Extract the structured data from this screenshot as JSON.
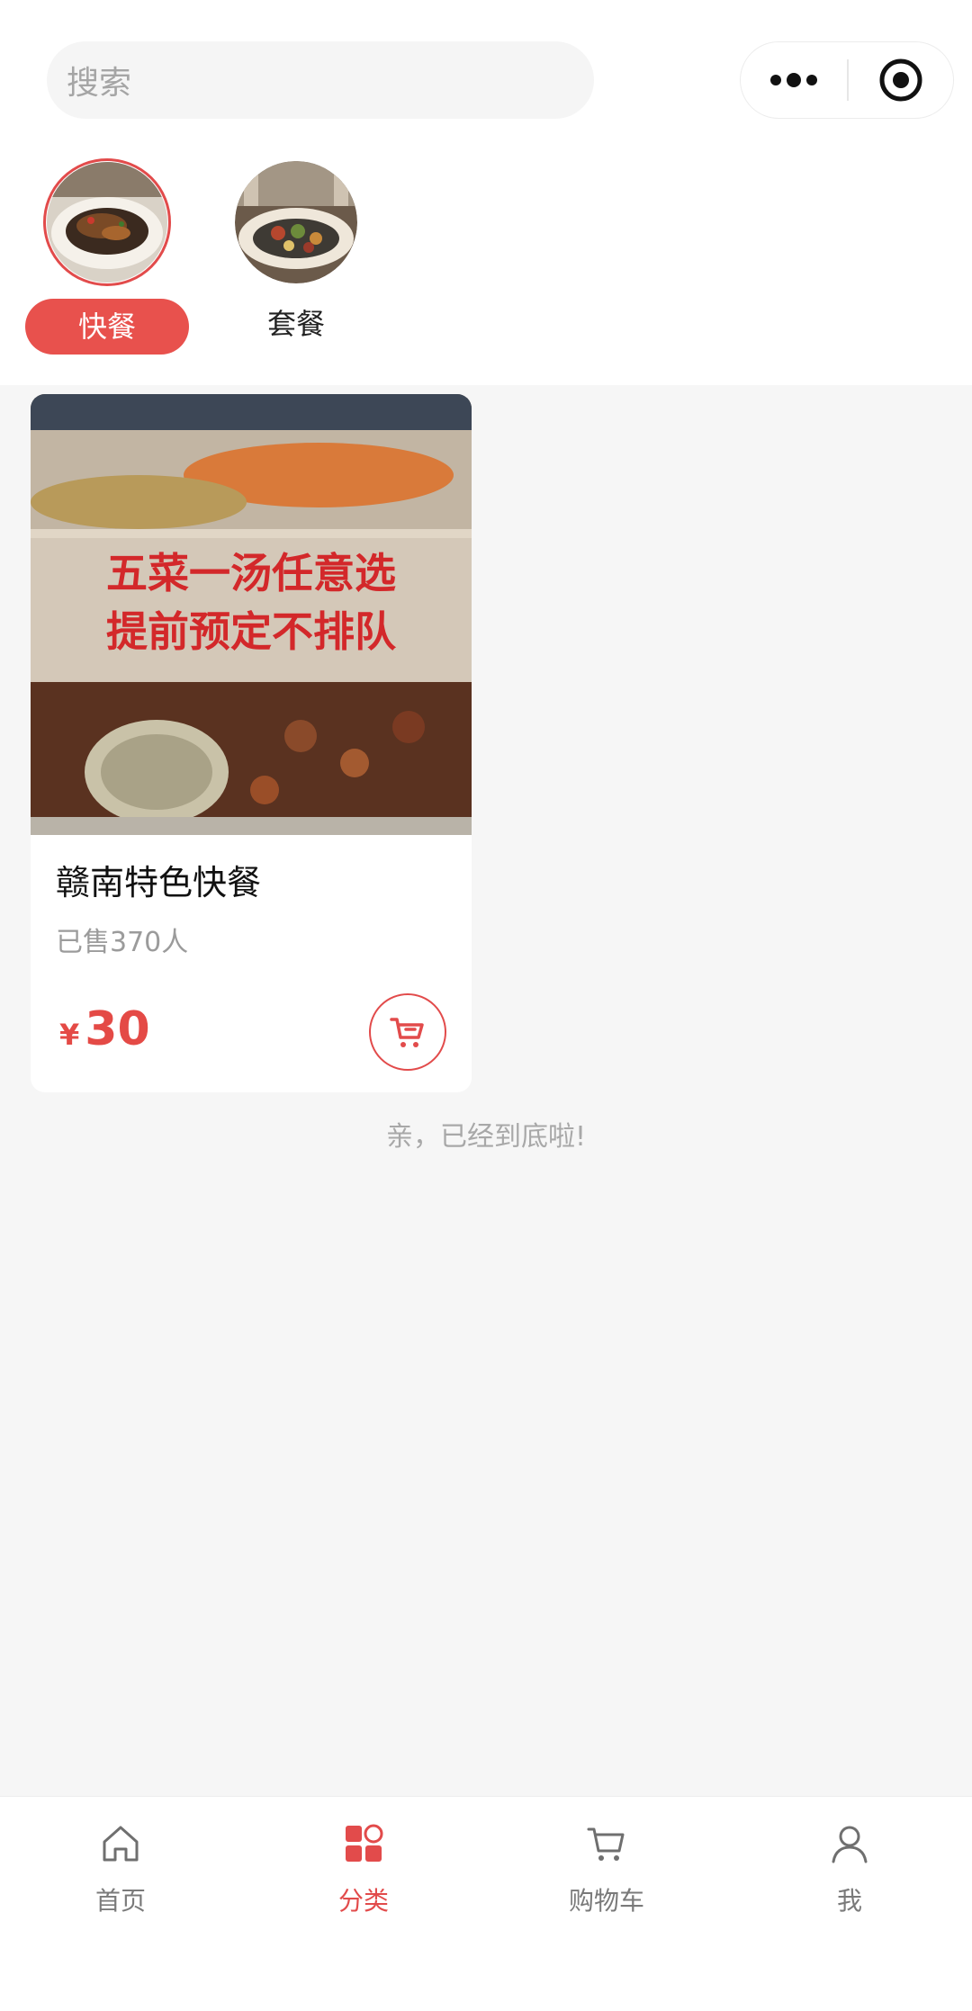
{
  "search": {
    "placeholder": "搜索"
  },
  "capsule": {
    "more_icon": "more-dots-icon",
    "target_icon": "target-icon"
  },
  "categories": [
    {
      "label": "快餐",
      "active": true
    },
    {
      "label": "套餐",
      "active": false
    }
  ],
  "product": {
    "banner_line1": "五菜一汤任意选",
    "banner_line2": "提前预定不排队",
    "title": "赣南特色快餐",
    "sold": "已售370人",
    "currency": "¥",
    "price": "30"
  },
  "end_note": "亲，已经到底啦!",
  "tabbar": {
    "items": [
      {
        "label": "首页",
        "icon": "home-icon",
        "active": false
      },
      {
        "label": "分类",
        "icon": "category-icon",
        "active": true
      },
      {
        "label": "购物车",
        "icon": "cart-icon",
        "active": false
      },
      {
        "label": "我",
        "icon": "user-icon",
        "active": false
      }
    ]
  },
  "colors": {
    "accent": "#e8514d",
    "background": "#f6f6f6"
  }
}
